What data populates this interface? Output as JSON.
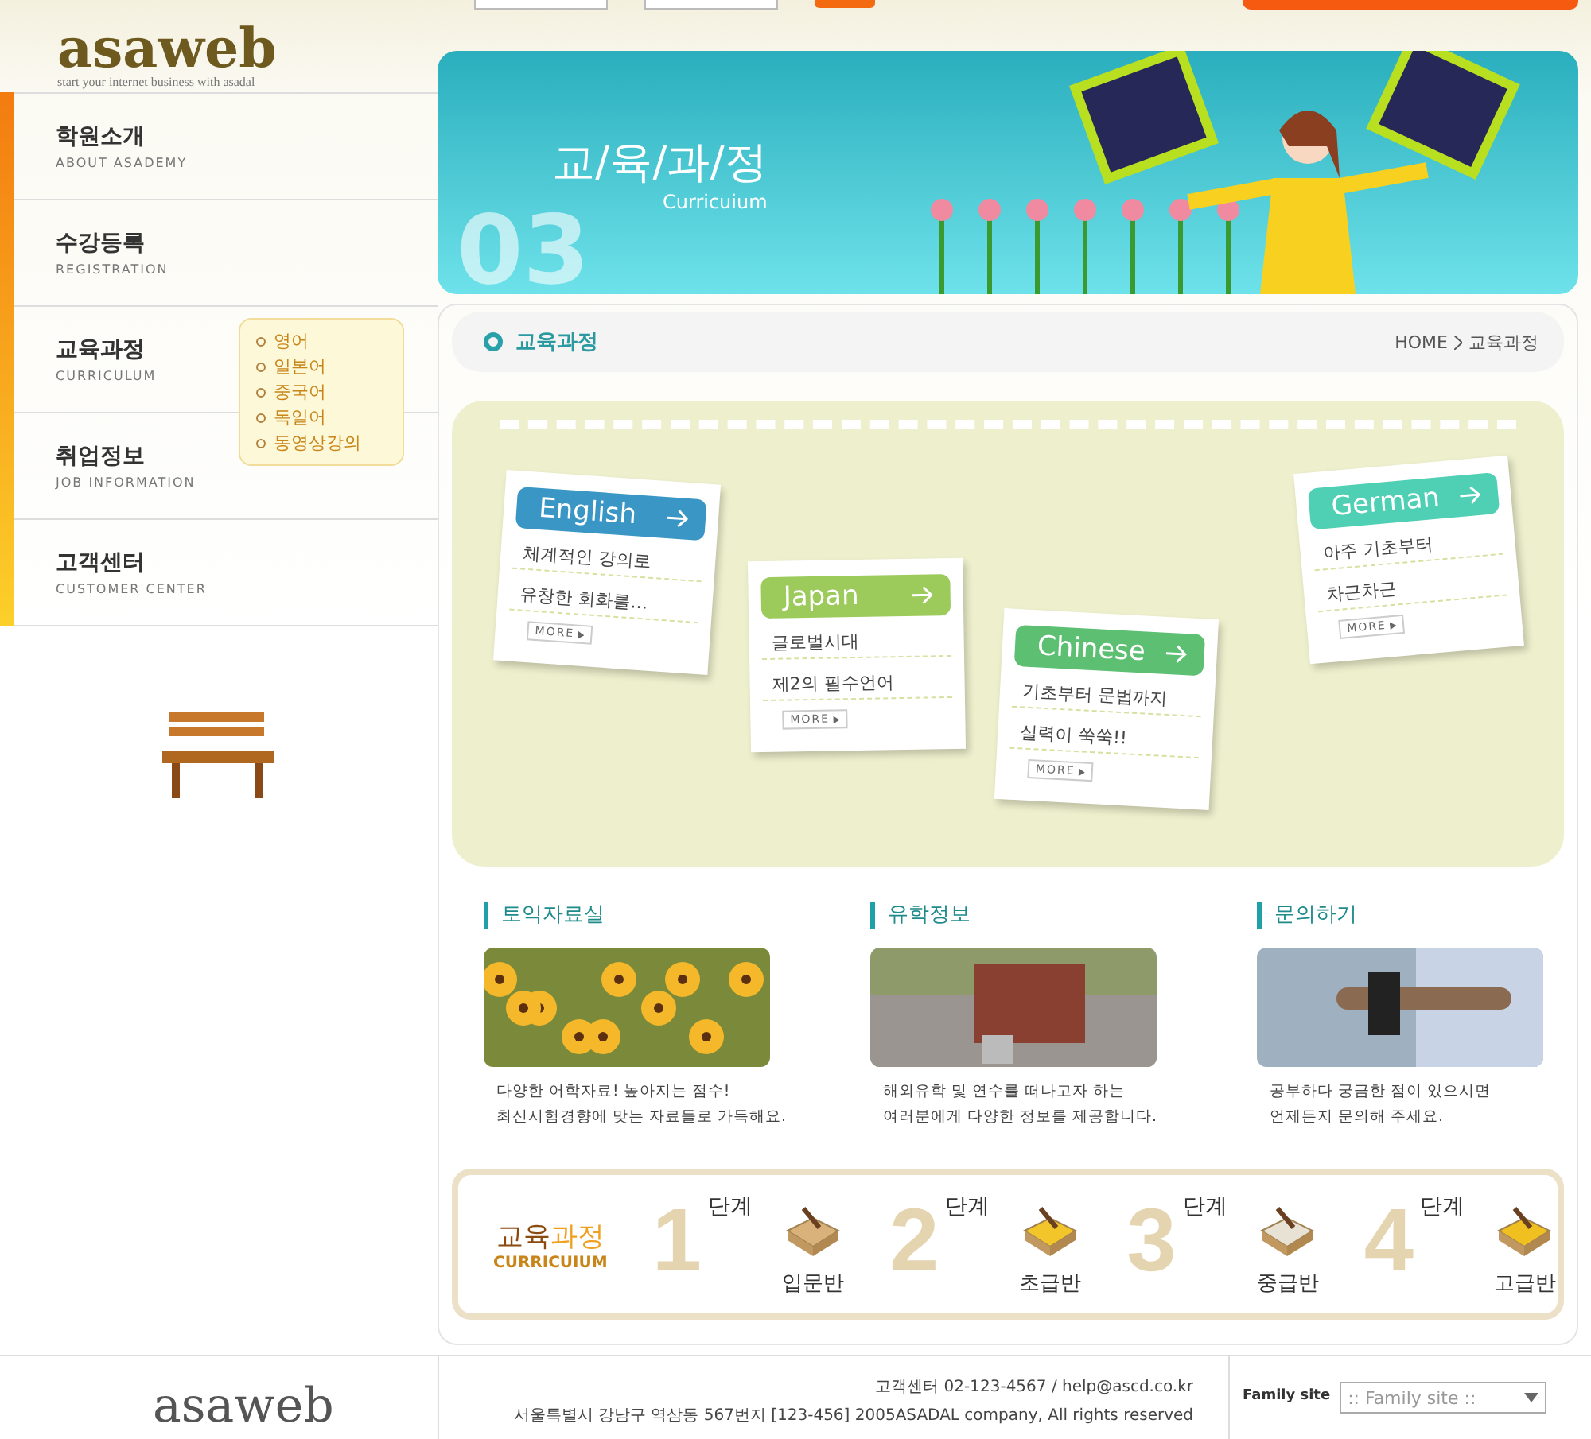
{
  "header": {
    "logo": "asaweb",
    "tagline": "start your internet business with asadal"
  },
  "nav": {
    "items": [
      {
        "title": "학원소개",
        "subtitle": "ABOUT ASADEMY"
      },
      {
        "title": "수강등록",
        "subtitle": "REGISTRATION"
      },
      {
        "title": "교육과정",
        "subtitle": "CURRICULUM"
      },
      {
        "title": "취업정보",
        "subtitle": "JOB INFORMATION"
      },
      {
        "title": "고객센터",
        "subtitle": "CUSTOMER CENTER"
      }
    ],
    "submenu": [
      "영어",
      "일본어",
      "중국어",
      "독일어",
      "동영상강의"
    ]
  },
  "banner": {
    "title": "교/육/과/정",
    "subtitle": "Curricuium",
    "number": "03"
  },
  "page_title": "교육과정",
  "breadcrumb": [
    "HOME",
    "교육과정"
  ],
  "notes": [
    {
      "language": "English",
      "color": "#3a96c4",
      "lines": [
        "체계적인 강의로",
        "유창한 회화를…"
      ],
      "more": "MORE"
    },
    {
      "language": "Japan",
      "color": "#9ccb5c",
      "lines": [
        "글로벌시대",
        "제2의 필수언어"
      ],
      "more": "MORE"
    },
    {
      "language": "Chinese",
      "color": "#5dbf72",
      "lines": [
        "기초부터 문법까지",
        "실력이 쑥쑥!!"
      ],
      "more": "MORE"
    },
    {
      "language": "German",
      "color": "#4fcfb4",
      "lines": [
        "아주 기초부터",
        "차근차근"
      ],
      "more": "MORE"
    }
  ],
  "sections": [
    {
      "title": "토익자료실",
      "lines": [
        "다양한 어학자료! 높아지는 점수!",
        "최신시험경향에 맞는 자료들로 가득해요."
      ]
    },
    {
      "title": "유학정보",
      "lines": [
        "해외유학 및 연수를 떠나고자 하는",
        "여러분에게 다양한 정보를 제공합니다."
      ]
    },
    {
      "title": "문의하기",
      "lines": [
        "공부하다 궁금한 점이 있으시면",
        "언제든지 문의해 주세요."
      ]
    }
  ],
  "steps": {
    "title_plain": "교육",
    "title_accent": "과정",
    "subtitle": "CURRICUIUM",
    "items": [
      {
        "number": "1",
        "unit": "단계",
        "label": "입문반"
      },
      {
        "number": "2",
        "unit": "단계",
        "label": "초급반"
      },
      {
        "number": "3",
        "unit": "단계",
        "label": "중급반"
      },
      {
        "number": "4",
        "unit": "단계",
        "label": "고급반"
      }
    ]
  },
  "footer": {
    "logo": "asaweb",
    "contact": "고객센터 02-123-4567 / help@ascd.co.kr",
    "address": "서울특별시 강남구 역삼동 567번지 [123-456] 2005ASADAL company, All rights reserved",
    "family_label": "Family site",
    "family_select": ":: Family site ::"
  }
}
